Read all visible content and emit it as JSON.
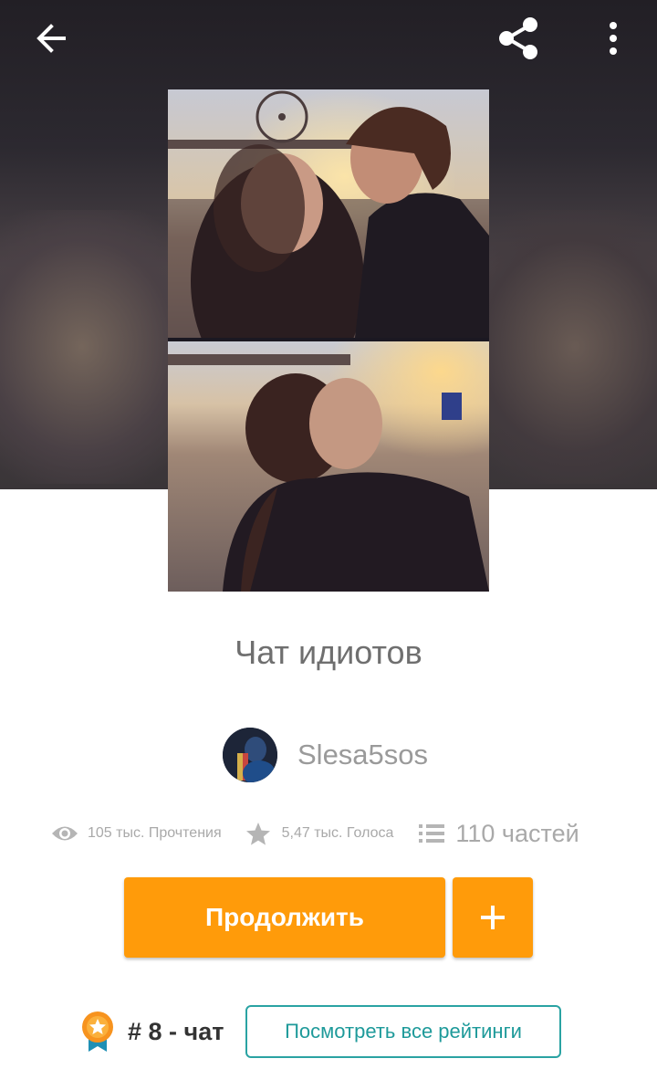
{
  "topbar": {
    "back_icon": "arrow-left-icon",
    "share_icon": "share-icon",
    "menu_icon": "more-vertical-icon"
  },
  "story": {
    "title": "Чат идиотов",
    "author": "Slesa5sos"
  },
  "stats": {
    "reads": "105 тыс. Прочтения",
    "votes": "5,47 тыс. Голоса",
    "parts": "110 частей"
  },
  "actions": {
    "continue_label": "Продолжить",
    "add_label": "+"
  },
  "ranking": {
    "rank_text": "# 8 - чат",
    "view_all_label": "Посмотреть все рейтинги"
  },
  "colors": {
    "accent_orange": "#ff9b0a",
    "teal": "#2aa3a3",
    "muted_text": "#a9a9a9"
  }
}
